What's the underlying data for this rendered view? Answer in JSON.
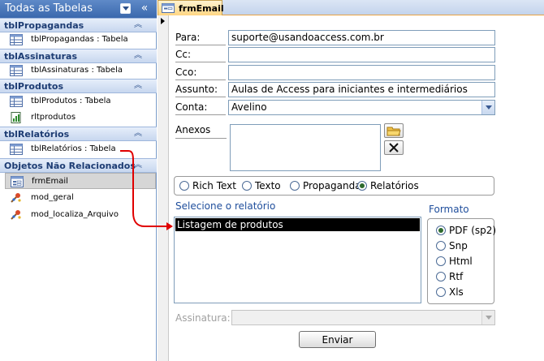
{
  "nav": {
    "title": "Todas as Tabelas",
    "groups": [
      {
        "label": "tblPropagandas",
        "items": [
          {
            "label": "tblPropagandas : Tabela",
            "icon": "table-icon"
          }
        ]
      },
      {
        "label": "tblAssinaturas",
        "items": [
          {
            "label": "tblAssinaturas : Tabela",
            "icon": "table-icon"
          }
        ]
      },
      {
        "label": "tblProdutos",
        "items": [
          {
            "label": "tblProdutos : Tabela",
            "icon": "table-icon"
          },
          {
            "label": "rltprodutos",
            "icon": "report-icon"
          }
        ]
      },
      {
        "label": "tblRelatórios",
        "items": [
          {
            "label": "tblRelatórios : Tabela",
            "icon": "table-icon"
          }
        ]
      },
      {
        "label": "Objetos Não Relacionados",
        "items": [
          {
            "label": "frmEmail",
            "icon": "form-icon"
          },
          {
            "label": "mod_geral",
            "icon": "module-icon"
          },
          {
            "label": "mod_localiza_Arquivo",
            "icon": "module-icon"
          }
        ]
      }
    ]
  },
  "tab": {
    "label": "frmEmail"
  },
  "form": {
    "para": {
      "label": "Para:",
      "value": "suporte@usandoaccess.com.br"
    },
    "cc": {
      "label": "Cc:",
      "value": ""
    },
    "cco": {
      "label": "Cco:",
      "value": ""
    },
    "assunto": {
      "label": "Assunto:",
      "value": "Aulas de Access para iniciantes e intermediários"
    },
    "conta": {
      "label": "Conta:",
      "value": "Avelino"
    },
    "anexos": {
      "label": "Anexos"
    },
    "tipo_options": [
      {
        "label": "Rich Text",
        "selected": false
      },
      {
        "label": "Texto",
        "selected": false
      },
      {
        "label": "Propaganda",
        "selected": false
      },
      {
        "label": "Relatórios",
        "selected": true
      }
    ],
    "relatorio": {
      "label": "Selecione o relatório",
      "items": [
        "Listagem de produtos"
      ],
      "selected": "Listagem de produtos"
    },
    "formato": {
      "label": "Formato",
      "options": [
        {
          "label": "PDF (sp2)",
          "selected": true
        },
        {
          "label": "Snp",
          "selected": false
        },
        {
          "label": "Html",
          "selected": false
        },
        {
          "label": "Rtf",
          "selected": false
        },
        {
          "label": "Xls",
          "selected": false
        }
      ]
    },
    "assinatura": {
      "label": "Assinatura:",
      "value": ""
    },
    "enviar_label": "Enviar"
  },
  "colors": {
    "nav_header": "#3a68ad",
    "group_label": "#1d3c73",
    "section_label": "#1f4e9c",
    "arrow": "#e00000",
    "tab": "#ffd47f"
  }
}
